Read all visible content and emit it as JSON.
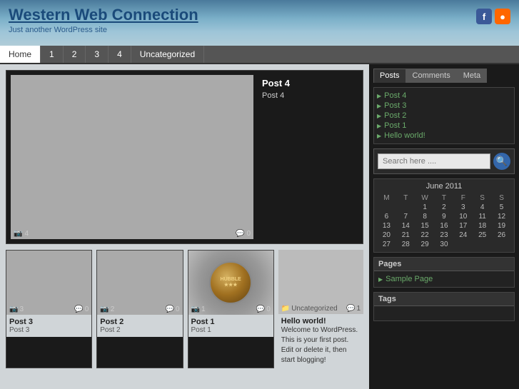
{
  "header": {
    "site_title": "Western Web Connection",
    "tagline": "Just another WordPress site",
    "facebook_label": "f",
    "rss_label": "rss"
  },
  "nav": {
    "items": [
      {
        "label": "Home",
        "active": true
      },
      {
        "label": "1",
        "active": false
      },
      {
        "label": "2",
        "active": false
      },
      {
        "label": "3",
        "active": false
      },
      {
        "label": "4",
        "active": false
      },
      {
        "label": "Uncategorized",
        "active": false
      }
    ]
  },
  "sidebar": {
    "tabs": [
      "Posts",
      "Comments",
      "Meta"
    ],
    "active_tab": "Posts",
    "recent_posts": [
      "Post 4",
      "Post 3",
      "Post 2",
      "Post 1",
      "Hello world!"
    ],
    "search_placeholder": "Search here ....",
    "calendar": {
      "title": "June 2011",
      "headers": [
        "M",
        "T",
        "W",
        "T",
        "F",
        "S",
        "S"
      ],
      "weeks": [
        [
          "",
          "",
          "1",
          "2",
          "3",
          "4",
          "5"
        ],
        [
          "6",
          "7",
          "8",
          "9",
          "10",
          "11",
          "12"
        ],
        [
          "13",
          "14",
          "15",
          "16",
          "17",
          "18",
          "19"
        ],
        [
          "20",
          "21",
          "22",
          "23",
          "24",
          "25",
          "26"
        ],
        [
          "27",
          "28",
          "29",
          "30",
          "",
          "",
          ""
        ]
      ]
    },
    "pages_title": "Pages",
    "pages_items": [
      "Sample Page"
    ],
    "tags_title": "Tags"
  },
  "featured_post": {
    "title": "Post 4",
    "subtitle": "Post 4",
    "image_count": "4",
    "comment_count": "0"
  },
  "thumb_posts": [
    {
      "title": "Post 3",
      "sub": "Post 3",
      "img_count": "3",
      "comment_count": "0"
    },
    {
      "title": "Post 2",
      "sub": "Post 2",
      "img_count": "2",
      "comment_count": "0"
    },
    {
      "title": "Post 1",
      "sub": "Post 1",
      "img_count": "1",
      "comment_count": "0"
    }
  ],
  "hello_world": {
    "category": "Uncategorized",
    "title": "Hello world!",
    "description": "Welcome to WordPress. This is your first post. Edit or delete it, then start blogging!",
    "comment_count": "1"
  }
}
